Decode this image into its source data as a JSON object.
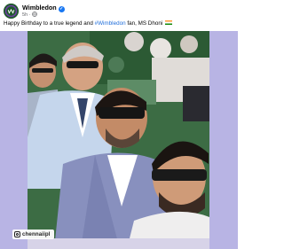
{
  "post": {
    "author": "Wimbledon",
    "timestamp": "5h",
    "privacy_icon": "globe-icon",
    "caption_before": "Happy Birthday to a true legend and ",
    "hashtag": "#Wimbledon",
    "caption_after": " fan, MS Dhoni",
    "caption_emoji": "india-flag-icon"
  },
  "photo": {
    "description_icon": "crowd-selfie-photo",
    "instagram_handle": "chennaiipl"
  },
  "colors": {
    "frame_bg": "#b8b4e4",
    "hashtag": "#216fdb",
    "verified": "#1877f2"
  }
}
